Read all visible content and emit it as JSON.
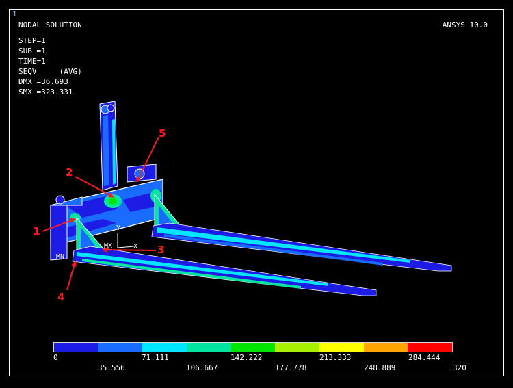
{
  "window_number": "1",
  "plot_title": "NODAL SOLUTION",
  "software": "ANSYS 10.0",
  "solution_info": [
    "STEP=1",
    "SUB =1",
    "TIME=1",
    "SEQV     (AVG)",
    "DMX =36.693",
    "SMX =323.331"
  ],
  "model": {
    "axis_labels": {
      "y": "Y",
      "x": "X"
    },
    "markers": {
      "max": "MX",
      "min": "MN"
    },
    "callouts": [
      "1",
      "2",
      "3",
      "4",
      "5"
    ]
  },
  "legend": {
    "colors": [
      "#1c1ce6",
      "#1a6bff",
      "#00e6ff",
      "#00e6a0",
      "#00e600",
      "#a6f000",
      "#ffff00",
      "#ffa500",
      "#ff0000"
    ],
    "labels_top": [
      "0",
      "71.111",
      "142.222",
      "213.333",
      "284.444"
    ],
    "labels_bottom": [
      "35.556",
      "106.667",
      "177.778",
      "248.889",
      "320"
    ]
  },
  "palette": {
    "callout_red": "#ff1a1a",
    "model_blue": "#1c1ce6",
    "model_mid": "#1a6bff",
    "model_cyan": "#00e6ff",
    "model_teal": "#00e6a0"
  }
}
